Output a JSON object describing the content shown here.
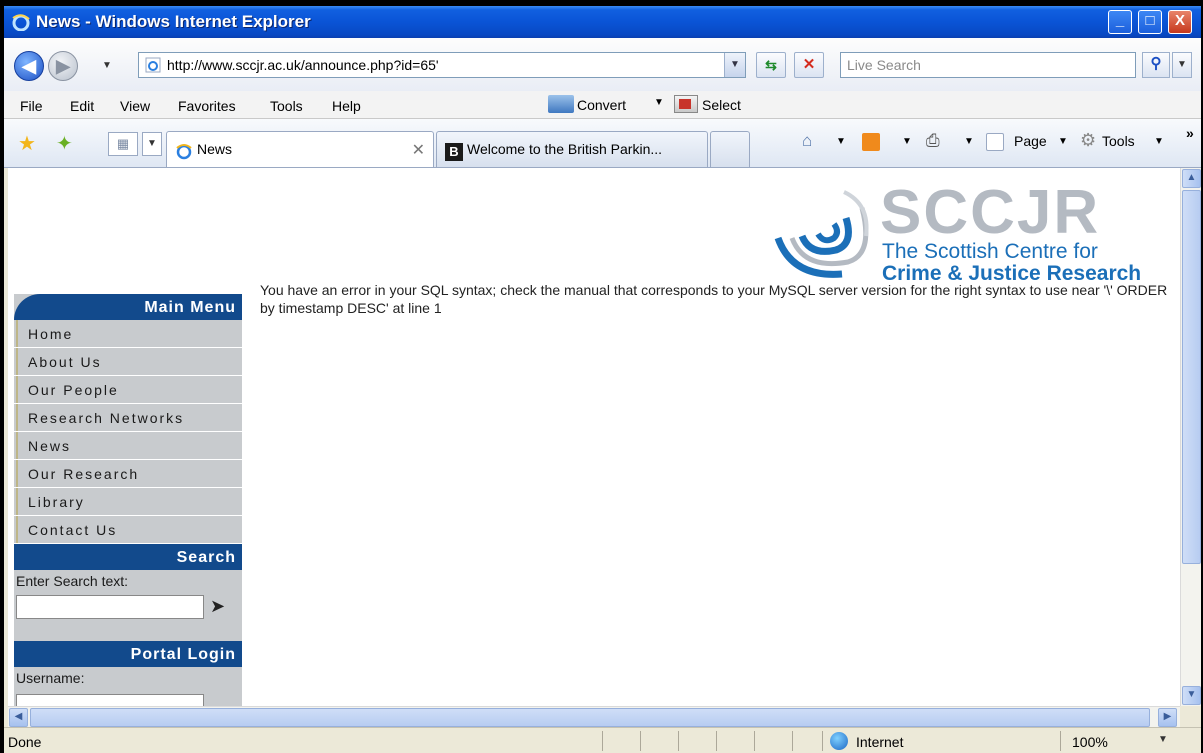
{
  "window": {
    "title": "News - Windows Internet Explorer",
    "min_label": "_",
    "max_label": "□",
    "close_label": "X"
  },
  "address_bar": {
    "url": "http://www.sccjr.ac.uk/announce.php?id=65'",
    "search_placeholder": "Live Search"
  },
  "menu": {
    "items": [
      "File",
      "Edit",
      "View",
      "Favorites",
      "Tools",
      "Help"
    ],
    "convert_label": "Convert",
    "select_label": "Select"
  },
  "tabs": [
    {
      "label": "News",
      "active": true
    },
    {
      "label": "Welcome to the British Parkin...",
      "active": false
    }
  ],
  "command_bar": {
    "page_label": "Page",
    "tools_label": "Tools",
    "more_label": "»"
  },
  "logo": {
    "acronym": "SCCJR",
    "line1": "The Scottish Centre for",
    "line2": "Crime & Justice Research"
  },
  "sidebar": {
    "main_menu_title": "Main Menu",
    "items": [
      "Home",
      "About Us",
      "Our People",
      "Research Networks",
      "News",
      "Our Research",
      "Library",
      "Contact Us"
    ],
    "search_title": "Search",
    "search_label": "Enter Search text:",
    "portal_title": "Portal Login",
    "username_label": "Username:"
  },
  "error_message": "You have an error in your SQL syntax; check the manual that corresponds to your MySQL server version for the right syntax to use near '\\' ORDER by timestamp DESC' at line 1",
  "status_bar": {
    "status": "Done",
    "zone": "Internet",
    "zoom": "100%"
  },
  "colors": {
    "titlebar": "#0a54d6",
    "sidebar_header": "#124a8c",
    "sidebar_bg": "#c8cbce",
    "logo_blue": "#1b6fb8",
    "logo_gray": "#b4bac2"
  }
}
